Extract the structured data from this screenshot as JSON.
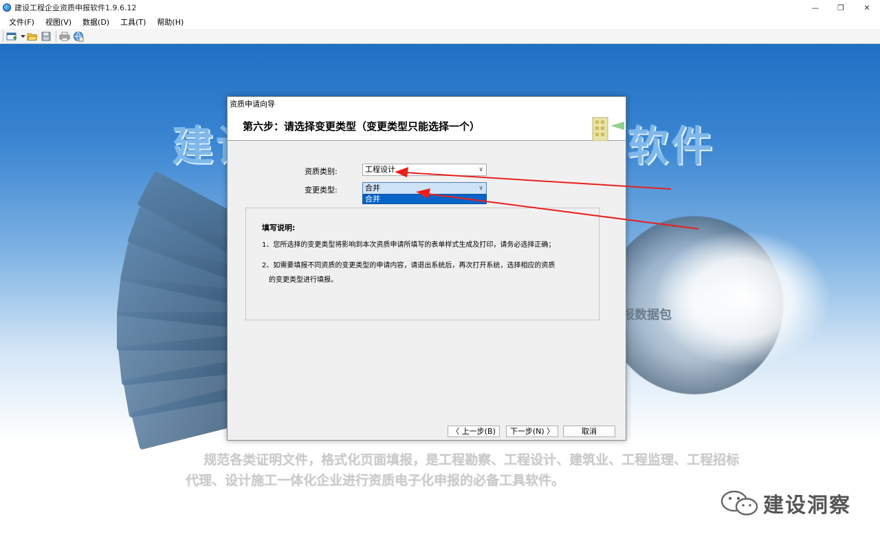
{
  "window": {
    "title": "建设工程企业资质申报软件1.9.6.12",
    "controls": {
      "minimize": "—",
      "maximize": "❐",
      "close": "✕"
    }
  },
  "menu": [
    "文件(F)",
    "视图(V)",
    "数据(D)",
    "工具(T)",
    "帮助(H)"
  ],
  "toolbar_icons": [
    "new-file-icon",
    "dropdown-arrow-icon",
    "open-folder-icon",
    "save-icon",
    "print-icon",
    "globe-icon"
  ],
  "background": {
    "title_left": "建设",
    "title_right": "软件",
    "package_text": "报数据包",
    "description": "规范各类证明文件，格式化页面填报，是工程勘察、工程设计、建筑业、工程监理、工程招标代理、设计施工一体化企业进行资质电子化申报的必备工具软件。",
    "watermark": "建设洞察"
  },
  "dialog": {
    "title": "资质申请向导",
    "step_heading": "第六步：请选择变更类型（变更类型只能选择一个）",
    "qualification_label": "资质类别:",
    "qualification_value": "工程设计",
    "change_type_label": "变更类型:",
    "change_type_value": "合并",
    "change_type_options": [
      "合并"
    ],
    "notes_title": "填写说明:",
    "notes": [
      "1、您所选择的变更类型将影响到本次资质申请所填写的表单样式生成及打印，请务必选择正确；",
      "2、如需要填报不同资质的变更类型的申请内容，请退出系统后，再次打开系统，选择相应的资质",
      "的变更类型进行填报。"
    ],
    "buttons": {
      "prev": "〈 上一步(B)",
      "next": "下一步(N) 〉",
      "cancel": "取消"
    }
  },
  "colors": {
    "annotation_arrow": "#e8201c",
    "selection": "#0a64c8"
  }
}
